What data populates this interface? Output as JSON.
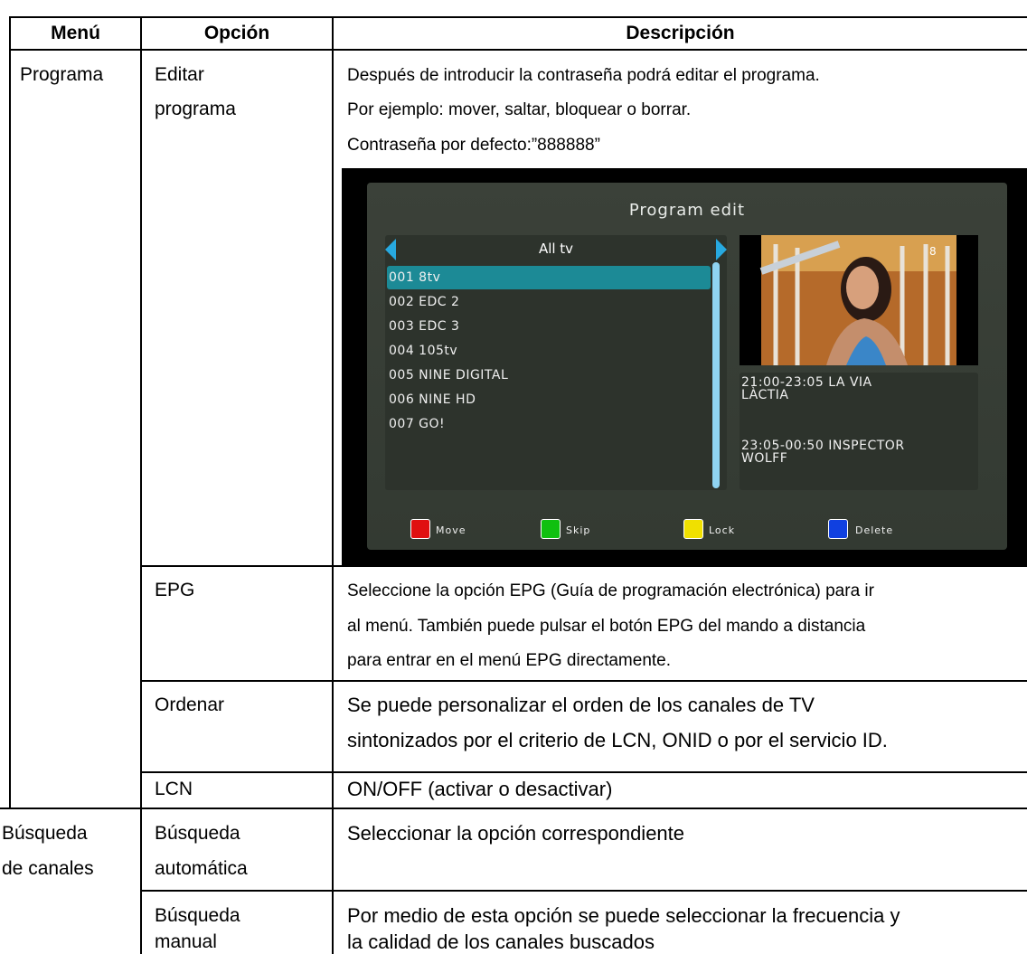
{
  "table": {
    "headers": {
      "menu": "Menú",
      "option": "Opción",
      "description": "Descripción"
    },
    "rows": {
      "programa": {
        "menu": "Programa",
        "editar": {
          "option_line1": "Editar",
          "option_line2": "programa",
          "desc_line1": "Después de introducir la contraseña podrá editar el programa.",
          "desc_line2": "Por ejemplo: mover, saltar, bloquear o borrar.",
          "desc_line3": "Contraseña por defecto:”888888”"
        },
        "epg": {
          "option": "EPG",
          "desc_line1": "Seleccione la opción EPG (Guía de programación electrónica) para ir",
          "desc_line2": "al menú. También puede pulsar el botón EPG del mando a distancia",
          "desc_line3": "para entrar en el menú EPG directamente."
        },
        "ordenar": {
          "option": "Ordenar",
          "desc_line1": "Se puede personalizar el orden de los canales de TV",
          "desc_line2": "sintonizados por el criterio de LCN, ONID o por el servicio ID."
        },
        "lcn": {
          "option": "LCN",
          "desc": "ON/OFF (activar o desactivar)"
        }
      },
      "busqueda": {
        "menu_line1": "Búsqueda",
        "menu_line2": "de canales",
        "auto": {
          "option_line1": "Búsqueda",
          "option_line2": "automática",
          "desc": "Seleccionar la opción correspondiente"
        },
        "manual": {
          "option_line1": "Búsqueda",
          "option_line2": "manual",
          "desc_line1": "Por medio de esta opción se puede seleccionar la frecuencia y",
          "desc_line2": "la calidad de los canales buscados"
        }
      }
    }
  },
  "screenshot": {
    "title": "Program edit",
    "list_header": "All tv",
    "channels": [
      "001 8tv",
      "002 EDC 2",
      "003 EDC 3",
      "004 105tv",
      "005 NINE DIGITAL",
      "006 NINE HD",
      "007 GO!"
    ],
    "preview_badge": "8",
    "epg": [
      {
        "line1": "21:00-23:05  LA VIA",
        "line2": "LÀCTIA"
      },
      {
        "line1": "23:05-00:50  INSPECTOR",
        "line2": "WOLFF"
      }
    ],
    "buttons": [
      {
        "label": "Move",
        "color": "#e01010"
      },
      {
        "label": "Skip",
        "color": "#10c010"
      },
      {
        "label": "Lock",
        "color": "#f0e000"
      },
      {
        "label": "Delete",
        "color": "#1040e0"
      }
    ]
  }
}
